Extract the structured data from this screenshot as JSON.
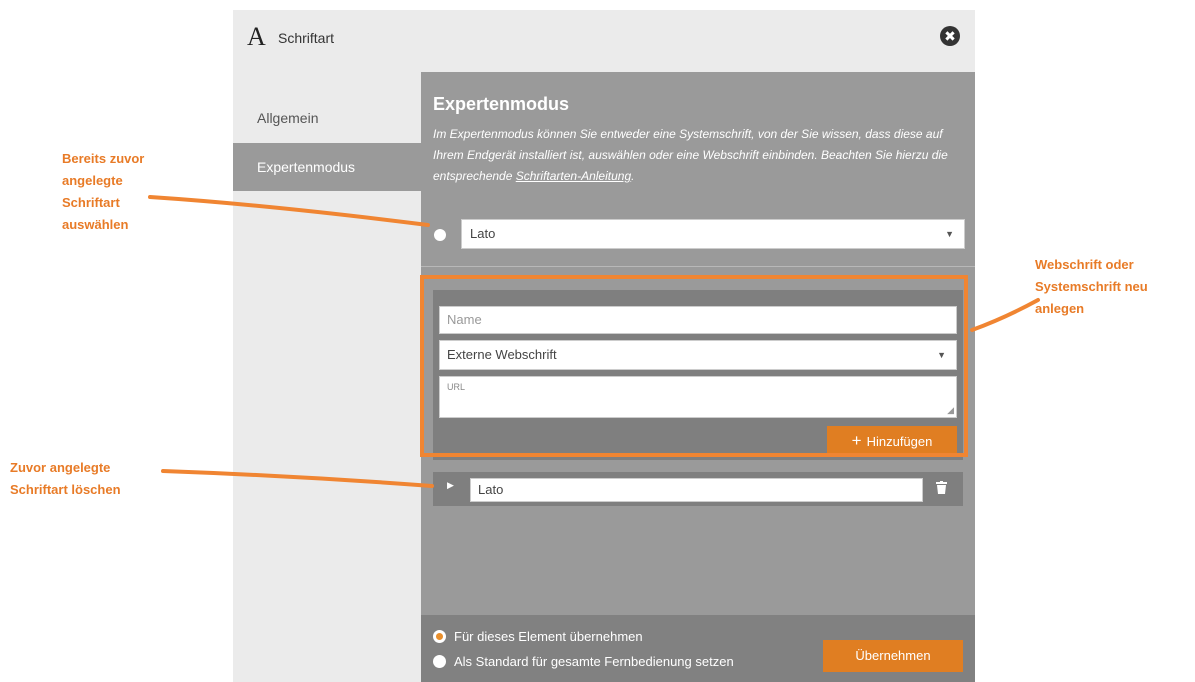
{
  "dialog": {
    "title_icon": "A",
    "title": "Schriftart",
    "close_icon": "✖"
  },
  "sidebar": {
    "items": [
      {
        "label": "Allgemein"
      },
      {
        "label": "Expertenmodus"
      }
    ]
  },
  "panel": {
    "title": "Expertenmodus",
    "description_prefix": "Im Expertenmodus können Sie entweder eine Systemschrift, von der Sie wissen, dass diese auf Ihrem Endgerät installiert ist, auswählen oder eine Webschrift einbinden. Beachten Sie hierzu die entsprechende ",
    "description_link": "Schriftarten-Anleitung",
    "description_suffix": ".",
    "existing_font_select": "Lato"
  },
  "new_font": {
    "name_placeholder": "Name",
    "type_select": "Externe Webschrift",
    "url_placeholder": "URL",
    "add_button_icon": "+",
    "add_button": "Hinzufügen"
  },
  "font_list": {
    "items": [
      {
        "name": "Lato"
      }
    ]
  },
  "footer": {
    "option_element": "Für dieses Element übernehmen",
    "option_default": "Als Standard für gesamte Fernbedienung setzen",
    "apply_button": "Übernehmen"
  },
  "annotations": {
    "select_existing": "Bereits zuvor\nangelegte\nSchriftart\nauswählen",
    "create_new": "Webschrift oder\nSystemschrift neu\nanlegen",
    "delete_existing": "Zuvor angelegte\nSchriftart löschen"
  },
  "colors": {
    "accent": "#e07e22",
    "annotation": "#f08532",
    "panel": "#9a9a9a",
    "sidebar": "#ebebeb"
  }
}
